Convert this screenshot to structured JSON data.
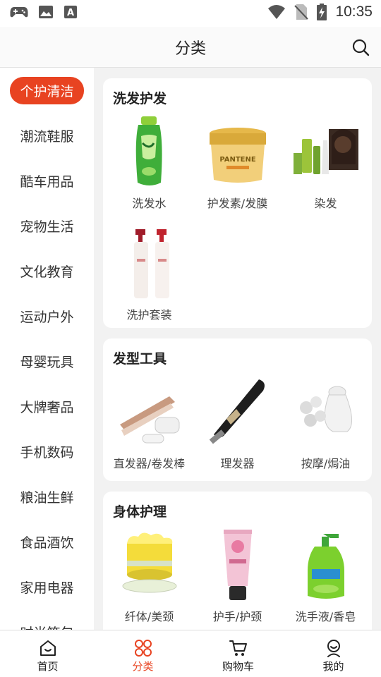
{
  "status_bar": {
    "time": "10:35"
  },
  "header": {
    "title": "分类"
  },
  "sidebar": {
    "items": [
      {
        "label": "个护清洁",
        "active": true
      },
      {
        "label": "潮流鞋服"
      },
      {
        "label": "酷车用品"
      },
      {
        "label": "宠物生活"
      },
      {
        "label": "文化教育"
      },
      {
        "label": "运动户外"
      },
      {
        "label": "母婴玩具"
      },
      {
        "label": "大牌奢品"
      },
      {
        "label": "手机数码"
      },
      {
        "label": "粮油生鲜"
      },
      {
        "label": "食品酒饮"
      },
      {
        "label": "家用电器"
      },
      {
        "label": "时尚箱包"
      }
    ]
  },
  "sections": [
    {
      "title": "洗发护发",
      "products": [
        {
          "label": "洗发水",
          "icon": "shampoo-bottle-icon"
        },
        {
          "label": "护发素/发膜",
          "icon": "hair-mask-jar-icon"
        },
        {
          "label": "染发",
          "icon": "hair-dye-kit-icon"
        },
        {
          "label": "洗护套装",
          "icon": "pump-bottles-icon"
        }
      ]
    },
    {
      "title": "发型工具",
      "products": [
        {
          "label": "直发器/卷发棒",
          "icon": "hair-straightener-icon"
        },
        {
          "label": "理发器",
          "icon": "hair-clipper-icon"
        },
        {
          "label": "按摩/焗油",
          "icon": "scalp-massager-icon"
        }
      ]
    },
    {
      "title": "身体护理",
      "products": [
        {
          "label": "纤体/美颈",
          "icon": "cream-jar-icon"
        },
        {
          "label": "护手/护颈",
          "icon": "hand-cream-tube-icon"
        },
        {
          "label": "洗手液/香皂",
          "icon": "hand-soap-bottle-icon"
        }
      ]
    }
  ],
  "bottom_nav": {
    "tabs": [
      {
        "label": "首页",
        "icon": "home-icon"
      },
      {
        "label": "分类",
        "icon": "category-grid-icon",
        "active": true
      },
      {
        "label": "购物车",
        "icon": "cart-icon"
      },
      {
        "label": "我的",
        "icon": "profile-icon"
      }
    ]
  },
  "colors": {
    "accent": "#e84321",
    "background": "#f2f2f2"
  }
}
